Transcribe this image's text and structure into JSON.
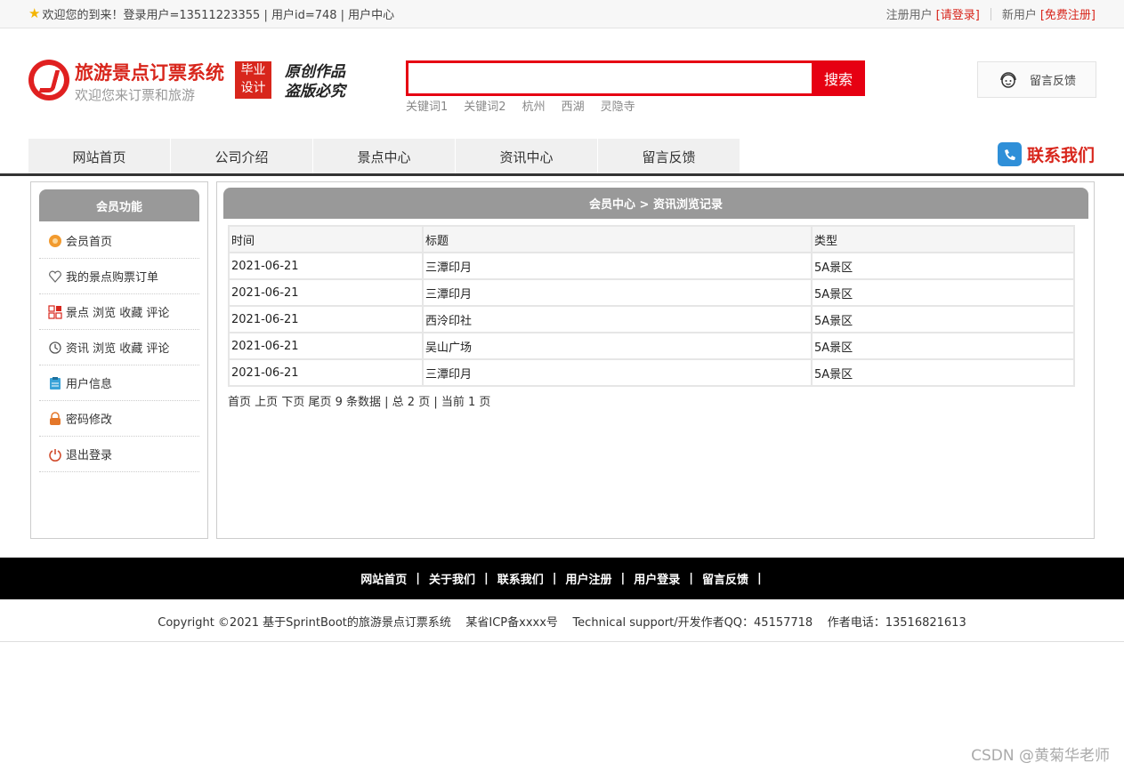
{
  "topbar": {
    "welcome": "欢迎您的到来！登录用户=13511223355 | 用户id=748 | 用户中心",
    "reg_user": "注册用户",
    "login_link": "[请登录]",
    "new_user": "新用户",
    "register_link": "[免费注册]"
  },
  "header": {
    "site_name": "旅游景点订票系统",
    "site_sub": "欢迎您来订票和旅游",
    "badge_line1": "毕业",
    "badge_line2": "设计",
    "orig_line1": "原创作品",
    "orig_line2": "盗版必究",
    "search_placeholder": "",
    "search_button": "搜索",
    "keywords": [
      "关键词1",
      "关键词2",
      "杭州",
      "西湖",
      "灵隐寺"
    ],
    "feedback": "留言反馈"
  },
  "nav": {
    "items": [
      "网站首页",
      "公司介绍",
      "景点中心",
      "资讯中心",
      "留言反馈"
    ],
    "contact": "联系我们"
  },
  "sidebar": {
    "title": "会员功能",
    "items": [
      {
        "label": "会员首页",
        "icon": "home-icon"
      },
      {
        "label": "我的景点购票订单",
        "icon": "heart-icon"
      },
      {
        "label": "景点 浏览 收藏 评论",
        "icon": "grid-icon"
      },
      {
        "label": "资讯 浏览 收藏 评论",
        "icon": "history-icon"
      },
      {
        "label": "用户信息",
        "icon": "clipboard-icon"
      },
      {
        "label": "密码修改",
        "icon": "lock-icon"
      },
      {
        "label": "退出登录",
        "icon": "power-icon"
      }
    ]
  },
  "main": {
    "title": "会员中心 > 资讯浏览记录",
    "columns": [
      "时间",
      "标题",
      "类型"
    ],
    "rows": [
      [
        "2021-06-21",
        "三潭印月",
        "5A景区"
      ],
      [
        "2021-06-21",
        "三潭印月",
        "5A景区"
      ],
      [
        "2021-06-21",
        "西泠印社",
        "5A景区"
      ],
      [
        "2021-06-21",
        "吴山广场",
        "5A景区"
      ],
      [
        "2021-06-21",
        "三潭印月",
        "5A景区"
      ]
    ],
    "pager_first": "首页",
    "pager_prev": "上页",
    "pager_next": "下页",
    "pager_last": "尾页",
    "pager_info": "9 条数据 | 总 2 页 | 当前 1 页"
  },
  "footer": {
    "links": [
      "网站首页",
      "关于我们",
      "联系我们",
      "用户注册",
      "用户登录",
      "留言反馈"
    ],
    "copyright": "Copyright ©2021 基于SprintBoot的旅游景点订票系统    某省ICP备xxxx号    Technical support/开发作者QQ：45157718    作者电话：13516821613",
    "watermark": "CSDN @黄菊华老师"
  },
  "colors": {
    "accent_red": "#e60012",
    "nav_bg": "#f0f0f0",
    "panel_header": "#999999"
  }
}
